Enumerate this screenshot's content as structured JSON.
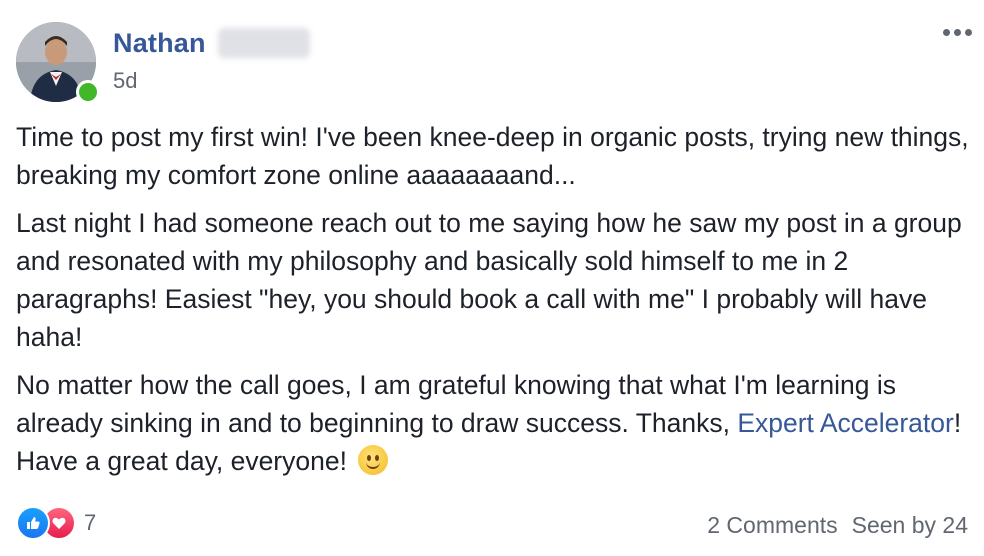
{
  "post": {
    "author_name": "Nathan",
    "timestamp": "5d",
    "paragraphs": {
      "p1": "Time to post my first win! I've been knee-deep in organic posts, trying new things, breaking my comfort zone online aaaaaaaand...",
      "p2": "Last night I had someone reach out to me saying how he saw my post in a group and resonated with my philosophy and basically sold himself to me in 2 paragraphs! Easiest \"hey, you should book a call with me\" I probably will have haha!",
      "p3_before_link": "No matter how the call goes, I am grateful knowing that what I'm learning is already sinking in and to beginning to draw success. Thanks, ",
      "p3_link": "Expert Accelerator",
      "p3_after_link": "! Have a great day, everyone! "
    },
    "emoji": "smiling-face-emoji"
  },
  "footer": {
    "reaction_icons": [
      "like-icon",
      "love-icon"
    ],
    "reaction_count": "7",
    "comments": "2 Comments",
    "seen_by": "Seen by 24"
  },
  "colors": {
    "link": "#365899",
    "text": "#1d2129",
    "meta": "#616770",
    "online": "#42b72a"
  }
}
